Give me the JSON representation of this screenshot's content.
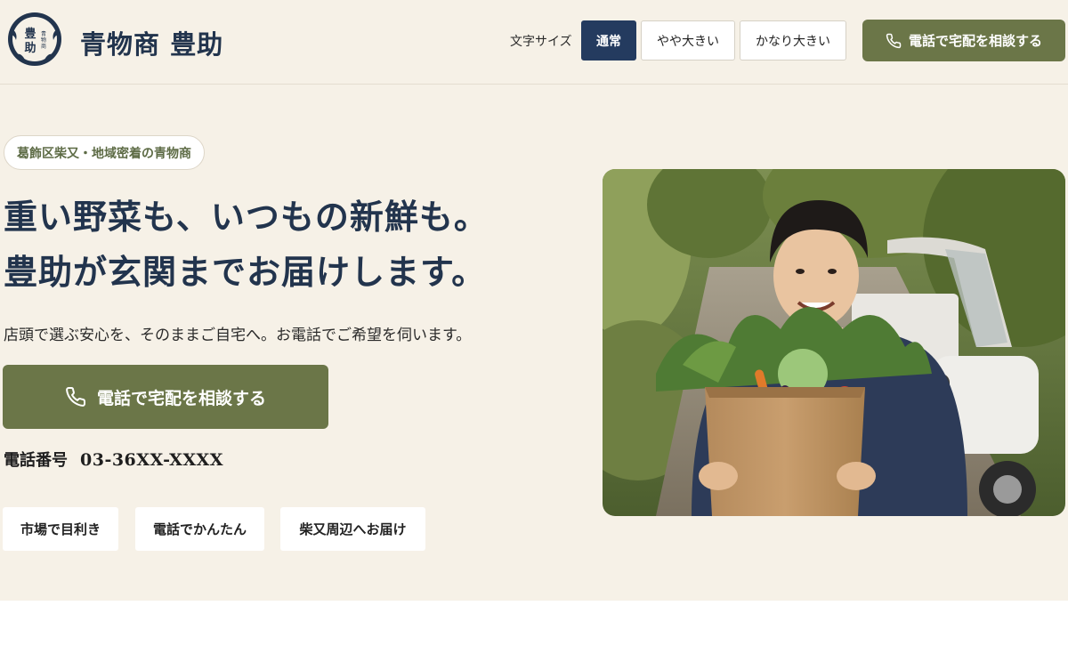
{
  "header": {
    "logo_icon": "house-crest-logo",
    "logo_text": "青物商豊助",
    "brand_name": "青物商 豊助",
    "font_size_label": "文字サイズ",
    "font_size_options": [
      "通常",
      "やや大きい",
      "かなり大きい"
    ],
    "font_size_selected": "通常",
    "cta_label": "電話で宅配を相談する",
    "cta_icon": "phone-icon"
  },
  "hero": {
    "tag": "葛飾区柴又・地域密着の青物商",
    "headline_line1": "重い野菜も、いつもの新鮮も。",
    "headline_line2": "豊助が玄関までお届けします。",
    "subtext": "店頭で選ぶ安心を、そのままご自宅へ。お電話でご希望を伺います。",
    "cta_label": "電話で宅配を相談する",
    "cta_icon": "phone-icon",
    "phone_label": "電話番号",
    "phone_number": "03-36XX-XXXX",
    "features": [
      "市場で目利き",
      "電話でかんたん",
      "柴又周辺へお届け"
    ],
    "photo_subject": "delivery-man-with-vegetable-bag-photo"
  },
  "colors": {
    "background": "#f6f1e7",
    "navy": "#22344d",
    "active_button": "#243b5f",
    "accent_green": "#6b7648",
    "tag_text": "#5d6b45"
  }
}
